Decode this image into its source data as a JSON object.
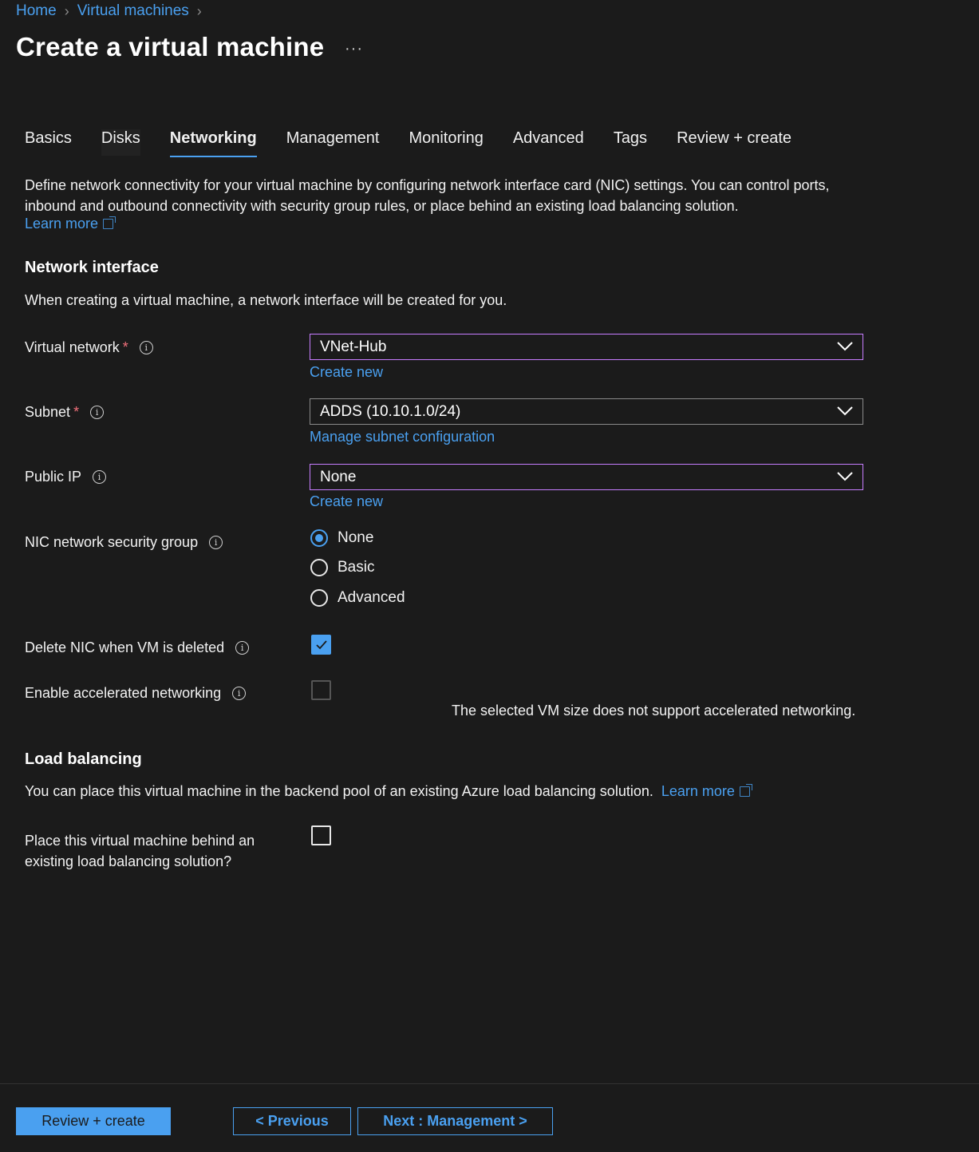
{
  "breadcrumb": {
    "home": "Home",
    "virtual_machines": "Virtual machines"
  },
  "page_title": "Create a virtual machine",
  "more_label": "···",
  "tabs": [
    {
      "label": "Basics"
    },
    {
      "label": "Disks"
    },
    {
      "label": "Networking"
    },
    {
      "label": "Management"
    },
    {
      "label": "Monitoring"
    },
    {
      "label": "Advanced"
    },
    {
      "label": "Tags"
    },
    {
      "label": "Review + create"
    }
  ],
  "active_tab": "Networking",
  "description": "Define network connectivity for your virtual machine by configuring network interface card (NIC) settings. You can control ports, inbound and outbound connectivity with security group rules, or place behind an existing load balancing solution.",
  "learn_more": "Learn more",
  "network_interface": {
    "heading": "Network interface",
    "subtext": "When creating a virtual machine, a network interface will be created for you.",
    "virtual_network": {
      "label": "Virtual network",
      "value": "VNet-Hub",
      "link": "Create new"
    },
    "subnet": {
      "label": "Subnet",
      "value": "ADDS (10.10.1.0/24)",
      "link": "Manage subnet configuration"
    },
    "public_ip": {
      "label": "Public IP",
      "value": "None",
      "link": "Create new"
    },
    "nsg": {
      "label": "NIC network security group",
      "options": [
        "None",
        "Basic",
        "Advanced"
      ],
      "selected": "None"
    },
    "delete_nic": {
      "label": "Delete NIC when VM is deleted",
      "checked": true
    },
    "accelerated": {
      "label": "Enable accelerated networking",
      "checked": false,
      "disabled": true,
      "note": "The selected VM size does not support accelerated networking."
    }
  },
  "load_balancing": {
    "heading": "Load balancing",
    "text": "You can place this virtual machine in the backend pool of an existing Azure load balancing solution.",
    "learn_more": "Learn more",
    "place_label_line1": "Place this virtual machine behind an",
    "place_label_line2": "existing load balancing solution?",
    "checked": false
  },
  "footer": {
    "review_create": "Review + create",
    "previous": "< Previous",
    "next": "Next : Management >"
  },
  "colors": {
    "accent": "#4aa0f0",
    "background": "#1b1b1b",
    "required": "#f1707b",
    "highlight_border": "#c77dff"
  },
  "icons": [
    "chevron-right-icon",
    "ellipsis-icon",
    "external-link-icon",
    "info-icon",
    "chevron-down-icon",
    "checkmark-icon"
  ]
}
